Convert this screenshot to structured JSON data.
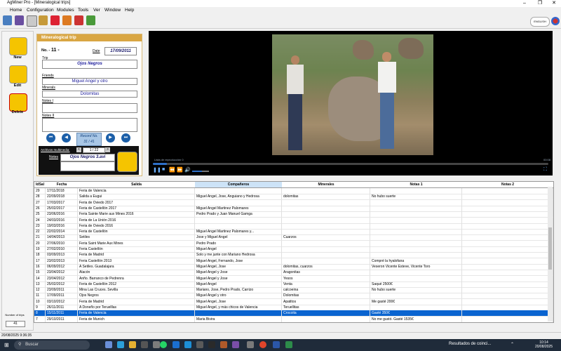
{
  "window": {
    "title": "AgMiner Pro - [Mineralogical trips]"
  },
  "menu": [
    "Home",
    "Configuration",
    "Modules",
    "Tools",
    "Ver",
    "Window",
    "Help"
  ],
  "language": "ENGLISH",
  "sidebar": {
    "new": "New",
    "edit": "Edit",
    "delete": "Delete",
    "count_label": "Number of trips",
    "count_value": "41"
  },
  "form": {
    "header": "Mineralogical trip",
    "no_label": "No. -",
    "no_value": "11 -",
    "date_label": "Date",
    "date_value": "17/09/2011",
    "trip_label": "Trip",
    "trip_value": "Ojos Negros",
    "friends_label": "Friends",
    "friends_value": "Miguel Angel y otro",
    "minerals_label": "Minerals",
    "minerals_value": "Dolomitas",
    "notes1_label": "Notes I",
    "notes2_label": "Notes II",
    "record_line1": "Record No.",
    "record_line2": "31 / 41",
    "multimedia_label": "Archivos multimedia:",
    "multimedia_index": "1 / 22",
    "notes_label": "Notes",
    "file_value": "Ojos Negros 3.avi"
  },
  "player": {
    "playlist": "Lista de reproducción 0",
    "time": "00:08"
  },
  "table": {
    "headers": [
      "IdSal",
      "Fecha",
      "Salida",
      "Compañeros",
      "Minerales",
      "Notas 1",
      "Notas 2"
    ],
    "selected_index": 21,
    "rows": [
      [
        "29",
        "17/11/2018",
        "Feria de Valencia",
        "",
        "",
        "",
        ""
      ],
      [
        "28",
        "22/09/2018",
        "Salida a Eugui",
        "Miguel Angel, Jose, Anguiano y Hedrosa",
        "dolomitas",
        "No hubo suerte",
        ""
      ],
      [
        "27",
        "17/03/2017",
        "Feria de Oviedo 2017",
        "",
        "",
        "",
        ""
      ],
      [
        "26",
        "25/02/2017",
        "Feria de Castellón 2017",
        "Miguel Angel Martinez Palomares",
        "",
        "",
        ""
      ],
      [
        "25",
        "23/06/2016",
        "Feria Sainte Marie aux Mines 2016",
        "Pedro Prado y Juan Manuel Gamga",
        "",
        "",
        ""
      ],
      [
        "24",
        "24/03/2016",
        "Feria de La Unión 2016",
        "",
        "",
        "",
        ""
      ],
      [
        "23",
        "19/03/2016",
        "Feria de Oviedo 2016",
        "",
        "",
        "",
        ""
      ],
      [
        "22",
        "22/02/2014",
        "Feria de Castellón",
        "Miguel Angel Martinez Palomares y...",
        "",
        "",
        ""
      ],
      [
        "21",
        "14/04/2013",
        "Setiles",
        "Jose y Miguel Angel",
        "Cuarzos",
        "",
        ""
      ],
      [
        "20",
        "27/06/2010",
        "Feria Saint Marie Aux Mines",
        "Pedro Prado",
        "",
        "",
        ""
      ],
      [
        "19",
        "27/02/2010",
        "Feria Castellón",
        "Miguel Angel",
        "",
        "",
        ""
      ],
      [
        "18",
        "03/09/2013",
        "Feria de Madrid",
        "Solo y me junte con Mariano Hedrosa",
        "",
        "",
        ""
      ],
      [
        "17",
        "23/02/2013",
        "Feria Castellón 2013",
        "Miguel Angel, Fernando, Jose",
        "",
        "Compré la hyalofana",
        ""
      ],
      [
        "16",
        "06/09/2012",
        "A Setiles. Guadalajara",
        "Miguel Angel, Jose",
        "dolomitas, cuarzos",
        "Veseron Vicente Esteve, Vicente Toro",
        ""
      ],
      [
        "15",
        "23/04/2012",
        "Alacón",
        "Miguel Angel y Jose",
        "Aragonitas",
        "",
        ""
      ],
      [
        "14",
        "23/04/2012",
        "Anño. Barranco de Pedrenra",
        "Miguel Angel y Jose",
        "Yesos",
        "",
        ""
      ],
      [
        "13",
        "25/02/2012",
        "Feria de Castellón 2012",
        "Miguel Angel",
        "Venta",
        "Saqué 2500€",
        ""
      ],
      [
        "12",
        "23/09/2011",
        "Mina Las Cruces. Sevilla",
        "Mariano, Jose, Pedro Prado, Carrizo",
        "calcoeina",
        "No hubo suerte",
        ""
      ],
      [
        "11",
        "17/09/2011",
        "Ojos Negros",
        "Miguel Angel y otro",
        "Dolomitas",
        "",
        ""
      ],
      [
        "10",
        "03/10/2012",
        "Feria de Madrid",
        "Miguel Angel, Jose",
        "Apatitos",
        "Me gasté 200€",
        ""
      ],
      [
        "9",
        "26/11/2011",
        "A Doneño por Teruelllas",
        "Miguel Angel, y más chicos de Valencia",
        "Teruellitas",
        "",
        ""
      ],
      [
        "8",
        "15/11/2011",
        "Feria de Valencia",
        "",
        "Crocoita",
        "Gasté 350€",
        ""
      ],
      [
        "7",
        "29/10/2011",
        "Feria de Munich",
        "Maria Bivira",
        "",
        "No me gustó. Gasté 1535€",
        ""
      ]
    ]
  },
  "statusbar": {
    "datetime": "20/08/2025 9:36:35"
  },
  "taskbar": {
    "search": "Buscar",
    "notification": "Resultados de coinci...",
    "time": "10:14",
    "date": "20/08/2025"
  }
}
